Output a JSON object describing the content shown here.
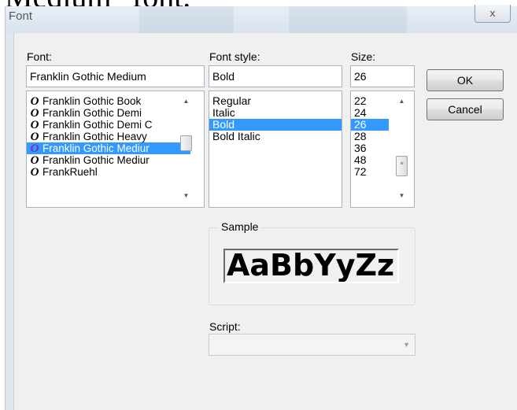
{
  "background": {
    "cropped_text": "Medium\" font."
  },
  "dialog": {
    "title": "Font",
    "close_glyph": "ⅹ"
  },
  "font": {
    "label": "Font:",
    "value": "Franklin Gothic Medium",
    "glyph": "O",
    "items": [
      {
        "name": "Franklin Gothic Book",
        "selected": false
      },
      {
        "name": "Franklin Gothic Demi",
        "selected": false
      },
      {
        "name": "Franklin Gothic Demi C",
        "selected": false
      },
      {
        "name": "Franklin Gothic Heavy",
        "selected": false
      },
      {
        "name": "Franklin Gothic Mediur",
        "selected": true
      },
      {
        "name": "Franklin Gothic Mediur",
        "selected": false
      },
      {
        "name": "FrankRuehl",
        "selected": false
      }
    ]
  },
  "style": {
    "label": "Font style:",
    "value": "Bold",
    "items": [
      {
        "name": "Regular",
        "selected": false
      },
      {
        "name": "Italic",
        "selected": false
      },
      {
        "name": "Bold",
        "selected": true
      },
      {
        "name": "Bold Italic",
        "selected": false
      }
    ]
  },
  "size": {
    "label": "Size:",
    "value": "26",
    "items": [
      {
        "name": "22",
        "selected": false
      },
      {
        "name": "24",
        "selected": false
      },
      {
        "name": "26",
        "selected": true
      },
      {
        "name": "28",
        "selected": false
      },
      {
        "name": "36",
        "selected": false
      },
      {
        "name": "48",
        "selected": false
      },
      {
        "name": "72",
        "selected": false
      }
    ]
  },
  "buttons": {
    "ok": "OK",
    "cancel": "Cancel"
  },
  "sample": {
    "label": "Sample",
    "text": "AaBbYyZz"
  },
  "script": {
    "label": "Script:",
    "value": ""
  },
  "colors": {
    "selection": "#3399ff",
    "dialog_bg": "#f0f0f0"
  }
}
